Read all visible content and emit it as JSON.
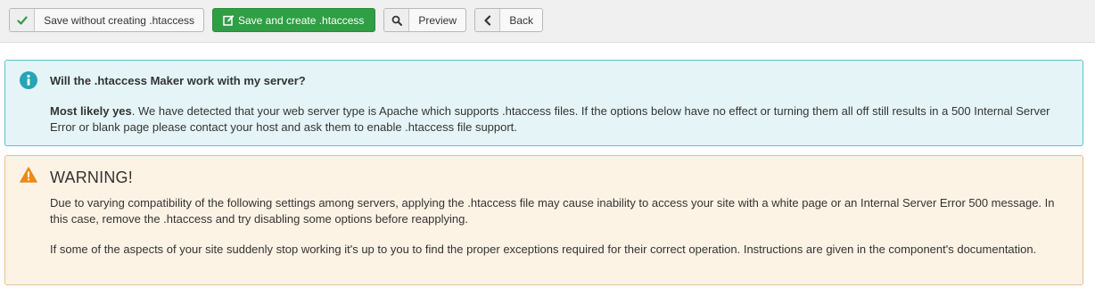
{
  "toolbar": {
    "save_without_label": "Save without creating .htaccess",
    "save_create_label": "Save and create .htaccess",
    "preview_label": "Preview",
    "back_label": "Back",
    "icons": {
      "save_without": "check-icon",
      "save_create": "edit-icon",
      "preview": "search-icon",
      "back": "chevron-left-icon"
    }
  },
  "info_alert": {
    "title": "Will the .htaccess Maker work with my server?",
    "body_bold": "Most likely yes",
    "body_text": ". We have detected that your web server type is Apache which supports .htaccess files. If the options below have no effect or turning them all off still results in a 500 Internal Server Error or blank page please contact your host and ask them to enable .htaccess file support.",
    "icon": "info-circle-icon"
  },
  "warning_alert": {
    "title": "WARNING!",
    "paragraph1": "Due to varying compatibility of the following settings among servers, applying the .htaccess file may cause inability to access your site with a white page or an Internal Server Error 500 message. In this case, remove the .htaccess and try disabling some options before reapplying.",
    "paragraph2": "If some of the aspects of your site suddenly stop working it's up to you to find the proper exceptions required for their correct operation. Instructions are given in the component's documentation.",
    "icon": "warning-triangle-icon"
  },
  "colors": {
    "green_button": "#2f9e44",
    "info_bg": "#e5f5f7",
    "info_border": "#5fc0cb",
    "info_icon": "#23a6b5",
    "warn_bg": "#fdf3e5",
    "warn_border": "#e9c08a",
    "warn_icon": "#e98a1c"
  }
}
